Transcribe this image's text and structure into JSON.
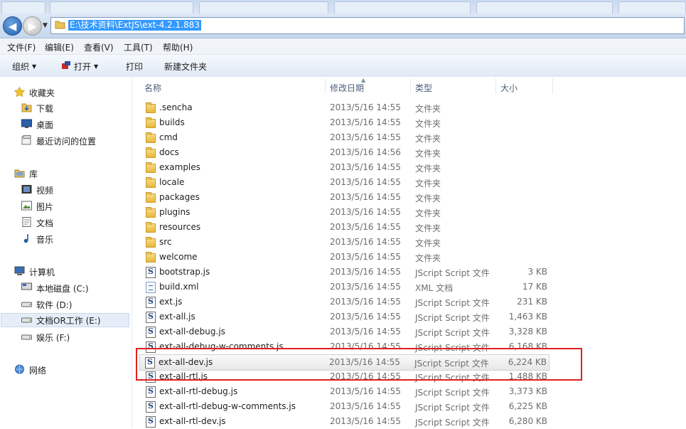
{
  "address": {
    "path": "E:\\技术资料\\ExtJS\\ext-4.2.1.883"
  },
  "menu": {
    "items": [
      "文件(F)",
      "编辑(E)",
      "查看(V)",
      "工具(T)",
      "帮助(H)"
    ]
  },
  "toolbar": {
    "organize": "组织",
    "open": "打开",
    "print": "打印",
    "new_folder": "新建文件夹"
  },
  "nav": {
    "favorites": "收藏夹",
    "downloads": "下载",
    "desktop": "桌面",
    "recent": "最近访问的位置",
    "libraries": "库",
    "videos": "视频",
    "pictures": "图片",
    "documents": "文档",
    "music": "音乐",
    "computer": "计算机",
    "drive_c": "本地磁盘 (C:)",
    "drive_d": "软件 (D:)",
    "drive_e": "文档OR工作 (E:)",
    "drive_f": "娱乐 (F:)",
    "network": "网络"
  },
  "columns": {
    "name": "名称",
    "date": "修改日期",
    "type": "类型",
    "size": "大小"
  },
  "files": [
    {
      "name": ".sencha",
      "date": "2013/5/16 14:55",
      "type": "文件夹",
      "size": "",
      "icon": "folder"
    },
    {
      "name": "builds",
      "date": "2013/5/16 14:55",
      "type": "文件夹",
      "size": "",
      "icon": "folder"
    },
    {
      "name": "cmd",
      "date": "2013/5/16 14:55",
      "type": "文件夹",
      "size": "",
      "icon": "folder"
    },
    {
      "name": "docs",
      "date": "2013/5/16 14:56",
      "type": "文件夹",
      "size": "",
      "icon": "folder"
    },
    {
      "name": "examples",
      "date": "2013/5/16 14:55",
      "type": "文件夹",
      "size": "",
      "icon": "folder"
    },
    {
      "name": "locale",
      "date": "2013/5/16 14:55",
      "type": "文件夹",
      "size": "",
      "icon": "folder"
    },
    {
      "name": "packages",
      "date": "2013/5/16 14:55",
      "type": "文件夹",
      "size": "",
      "icon": "folder"
    },
    {
      "name": "plugins",
      "date": "2013/5/16 14:55",
      "type": "文件夹",
      "size": "",
      "icon": "folder"
    },
    {
      "name": "resources",
      "date": "2013/5/16 14:55",
      "type": "文件夹",
      "size": "",
      "icon": "folder"
    },
    {
      "name": "src",
      "date": "2013/5/16 14:55",
      "type": "文件夹",
      "size": "",
      "icon": "folder"
    },
    {
      "name": "welcome",
      "date": "2013/5/16 14:55",
      "type": "文件夹",
      "size": "",
      "icon": "folder"
    },
    {
      "name": "bootstrap.js",
      "date": "2013/5/16 14:55",
      "type": "JScript Script 文件",
      "size": "3 KB",
      "icon": "js"
    },
    {
      "name": "build.xml",
      "date": "2013/5/16 14:55",
      "type": "XML 文档",
      "size": "17 KB",
      "icon": "xml"
    },
    {
      "name": "ext.js",
      "date": "2013/5/16 14:55",
      "type": "JScript Script 文件",
      "size": "231 KB",
      "icon": "js"
    },
    {
      "name": "ext-all.js",
      "date": "2013/5/16 14:55",
      "type": "JScript Script 文件",
      "size": "1,463 KB",
      "icon": "js"
    },
    {
      "name": "ext-all-debug.js",
      "date": "2013/5/16 14:55",
      "type": "JScript Script 文件",
      "size": "3,328 KB",
      "icon": "js"
    },
    {
      "name": "ext-all-debug-w-comments.js",
      "date": "2013/5/16 14:55",
      "type": "JScript Script 文件",
      "size": "6,168 KB",
      "icon": "js"
    },
    {
      "name": "ext-all-dev.js",
      "date": "2013/5/16 14:55",
      "type": "JScript Script 文件",
      "size": "6,224 KB",
      "icon": "js",
      "highlighted": true
    },
    {
      "name": "ext-all-rtl.js",
      "date": "2013/5/16 14:55",
      "type": "JScript Script 文件",
      "size": "1,488 KB",
      "icon": "js"
    },
    {
      "name": "ext-all-rtl-debug.js",
      "date": "2013/5/16 14:55",
      "type": "JScript Script 文件",
      "size": "3,373 KB",
      "icon": "js"
    },
    {
      "name": "ext-all-rtl-debug-w-comments.js",
      "date": "2013/5/16 14:55",
      "type": "JScript Script 文件",
      "size": "6,225 KB",
      "icon": "js"
    },
    {
      "name": "ext-all-rtl-dev.js",
      "date": "2013/5/16 14:55",
      "type": "JScript Script 文件",
      "size": "6,280 KB",
      "icon": "js"
    }
  ],
  "colors": {
    "annotation": "#e02020",
    "selection": "#3399ff"
  }
}
